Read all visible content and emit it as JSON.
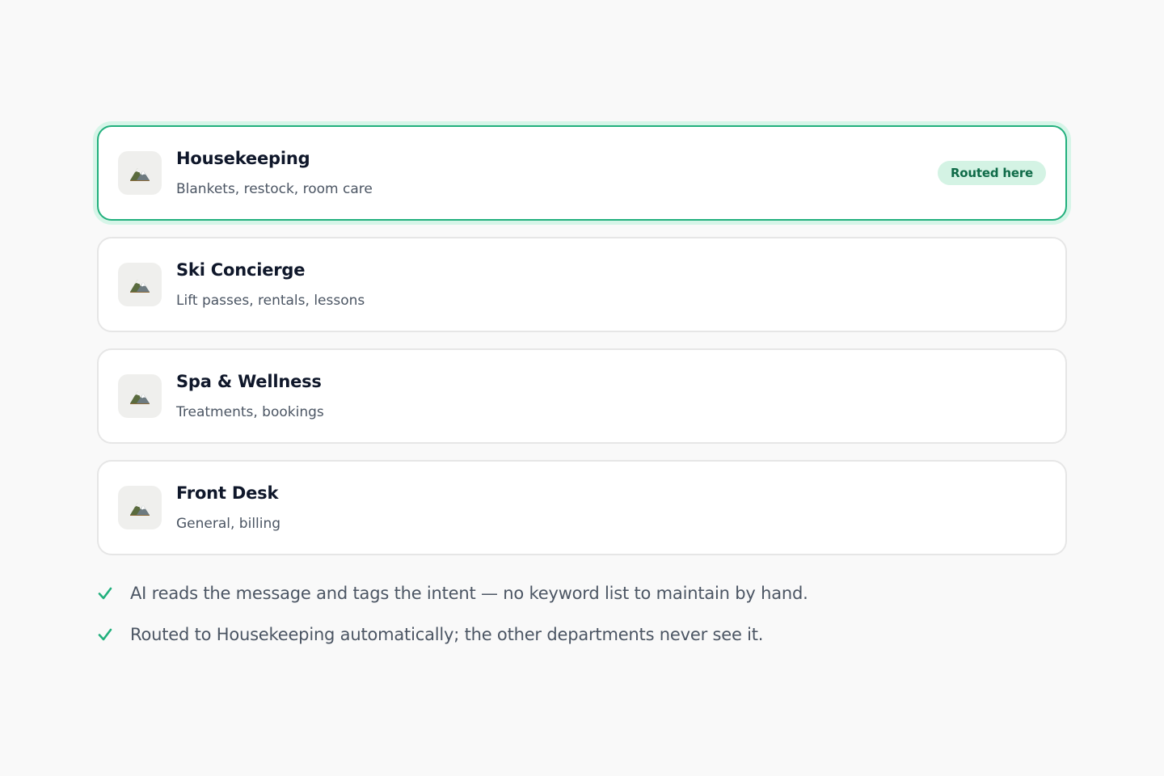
{
  "departments": [
    {
      "name": "Housekeeping",
      "description": "Blankets, restock, room care",
      "icon": "mountain-icon",
      "badge": "Routed here",
      "active": true
    },
    {
      "name": "Ski Concierge",
      "description": "Lift passes, rentals, lessons",
      "icon": "mountain-icon",
      "active": false
    },
    {
      "name": "Spa & Wellness",
      "description": "Treatments, bookings",
      "icon": "mountain-icon",
      "active": false
    },
    {
      "name": "Front Desk",
      "description": "General, billing",
      "icon": "mountain-icon",
      "active": false
    }
  ],
  "notes": [
    {
      "icon": "check-icon",
      "text": "AI reads the message and tags the intent — no keyword list to maintain by hand."
    },
    {
      "icon": "check-icon",
      "text": "Routed to Housekeeping automatically; the other departments never see it."
    }
  ],
  "colors": {
    "accent": "#22b07d",
    "badge_bg": "#d4f3e4",
    "badge_text": "#0f6b48",
    "background": "#f9f9f9"
  }
}
